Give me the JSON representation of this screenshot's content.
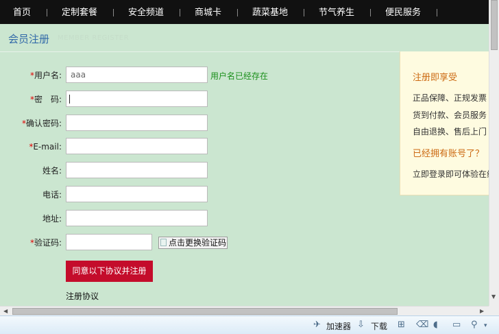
{
  "nav": {
    "items": [
      "首页",
      "定制套餐",
      "安全频道",
      "商城卡",
      "蔬菜基地",
      "节气养生",
      "便民服务"
    ]
  },
  "section": {
    "title": "会员注册",
    "subtitle": "MEMBER REGISTER"
  },
  "form": {
    "username_label": "用户名:",
    "username_value": "aaa",
    "username_hint": "用户名已经存在",
    "password_label": "密　码:",
    "confirm_label": "确认密码:",
    "email_label": "E-mail:",
    "name_label": "姓名:",
    "phone_label": "电话:",
    "address_label": "地址:",
    "captcha_label": "验证码:",
    "captcha_image_alt": "点击更换验证码",
    "submit_label": "同意以下协议并注册",
    "agreement_label": "注册协议",
    "required_mark": "*"
  },
  "panel": {
    "heading": "注册即享受",
    "lines": [
      "正品保障、正规发票",
      "货到付款、会员服务",
      "自由退换、售后上门"
    ],
    "login_heading": "已经拥有账号了？",
    "login_text": "立即登录即可体验在线"
  },
  "statusbar": {
    "accelerator": "加速器",
    "download": "下载"
  },
  "colors": {
    "page_bg": "#cbe6d0",
    "nav_bg": "#111111",
    "submit_bg": "#c40c2b",
    "hint": "#1a8f1a",
    "panel_heading": "#cc6a12"
  }
}
